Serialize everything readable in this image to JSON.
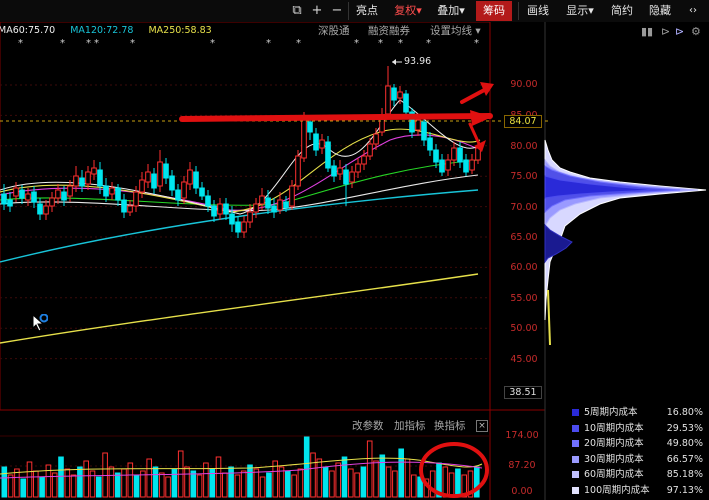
{
  "toolbar": {
    "buttons": [
      {
        "label": "亮点",
        "active": false
      },
      {
        "label": "复权▾",
        "active": false,
        "color": "#ff4d4d"
      },
      {
        "label": "叠加▾",
        "active": false
      },
      {
        "label": "筹码",
        "active": true
      },
      {
        "label": "画线",
        "active": false
      },
      {
        "label": "显示▾",
        "active": false
      },
      {
        "label": "简约",
        "active": false
      },
      {
        "label": "隐藏",
        "active": false
      }
    ],
    "icons": [
      "window-icon",
      "plus-icon",
      "minus-icon"
    ],
    "extra_glyph": "‹›"
  },
  "moving_averages": [
    {
      "label": "MA60:75.70",
      "color": "#f0f0f0"
    },
    {
      "label": "MA120:72.78",
      "color": "#18c4d8"
    },
    {
      "label": "MA250:58.83",
      "color": "#e6e04a"
    }
  ],
  "info_links": [
    "深股通",
    "融资融券",
    "设置均线 ▾"
  ],
  "price_axis": {
    "ticks": [
      "90.00",
      "85.00",
      "80.00",
      "75.00",
      "70.00",
      "65.00",
      "60.00",
      "55.00",
      "50.00",
      "45.00"
    ],
    "current_price": "84.07",
    "bottom_price": "38.51",
    "high_annotation": "93.96"
  },
  "volume_panel": {
    "links": [
      "改参数",
      "加指标",
      "换指标"
    ],
    "close": "×",
    "ticks": [
      "174.00",
      "87.20",
      "0.00"
    ]
  },
  "chip_legend": [
    {
      "label": "5周期内成本",
      "pct": "16.80%",
      "color": "#2a2ad8"
    },
    {
      "label": "10周期内成本",
      "pct": "29.53%",
      "color": "#4b4bee"
    },
    {
      "label": "20周期内成本",
      "pct": "49.80%",
      "color": "#7070ff"
    },
    {
      "label": "30周期内成本",
      "pct": "66.57%",
      "color": "#9a9aff"
    },
    {
      "label": "60周期内成本",
      "pct": "85.18%",
      "color": "#c0c0ff"
    },
    {
      "label": "100周期内成本",
      "pct": "97.13%",
      "color": "#e3e3ff"
    }
  ],
  "accent_colors": {
    "up": "#ff3030",
    "down": "#00e5ee",
    "annotation": "#e01010"
  }
}
